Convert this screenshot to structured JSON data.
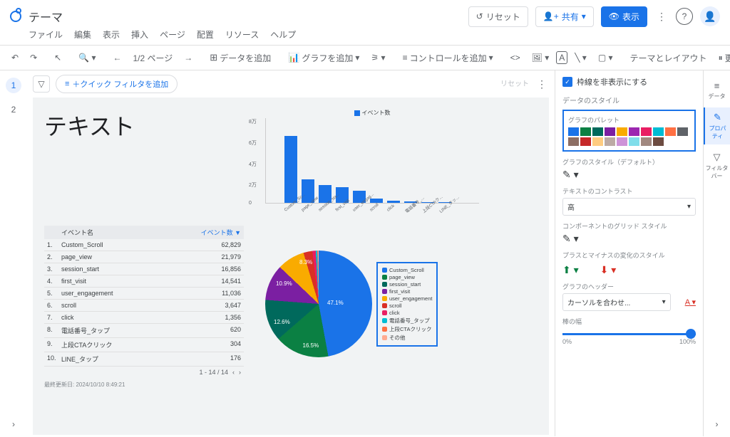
{
  "header": {
    "title": "テーマ",
    "reset": "リセット",
    "share": "共有",
    "view": "表示"
  },
  "menu": [
    "ファイル",
    "編集",
    "表示",
    "挿入",
    "ページ",
    "配置",
    "リソース",
    "ヘルプ"
  ],
  "toolbar": {
    "page_info": "1/2 ページ",
    "add_data": "データを追加",
    "add_chart": "グラフを追加",
    "add_control": "コントロールを追加",
    "theme_layout": "テーマとレイアウト",
    "pause_update": "更新を一時停止"
  },
  "filter": {
    "quick": "＋クイック フィルタを追加",
    "reset": "リセット"
  },
  "canvas": {
    "text_title": "テキスト",
    "updated": "最終更新日: 2024/10/10 8:49:21",
    "table": {
      "col_name": "イベント名",
      "col_count": "イベント数",
      "rows": [
        {
          "n": "1.",
          "name": "Custom_Scroll",
          "v": "62,829"
        },
        {
          "n": "2.",
          "name": "page_view",
          "v": "21,979"
        },
        {
          "n": "3.",
          "name": "session_start",
          "v": "16,856"
        },
        {
          "n": "4.",
          "name": "first_visit",
          "v": "14,541"
        },
        {
          "n": "5.",
          "name": "user_engagement",
          "v": "11,036"
        },
        {
          "n": "6.",
          "name": "scroll",
          "v": "3,647"
        },
        {
          "n": "7.",
          "name": "click",
          "v": "1,356"
        },
        {
          "n": "8.",
          "name": "電話番号_タップ",
          "v": "620"
        },
        {
          "n": "9.",
          "name": "上段CTAクリック",
          "v": "304"
        },
        {
          "n": "10.",
          "name": "LINE_タップ",
          "v": "176"
        }
      ],
      "footer": "1 - 14 / 14"
    }
  },
  "chart_data": [
    {
      "type": "bar",
      "title": "",
      "legend": "イベント数",
      "categories": [
        "Custom_Sc...",
        "page_view",
        "session_sta...",
        "first_visit",
        "user_engag...",
        "scroll",
        "click",
        "電話番号_...",
        "上段CTAク...",
        "LINE_タッ..."
      ],
      "values": [
        62829,
        21979,
        16856,
        14541,
        11036,
        3647,
        1356,
        620,
        304,
        176
      ],
      "ylim": [
        0,
        80000
      ],
      "yticks": [
        "8万",
        "6万",
        "4万",
        "2万",
        "0"
      ]
    },
    {
      "type": "pie",
      "labels_shown": [
        "47.1%",
        "16.5%",
        "12.6%",
        "10.9%",
        "8.3%"
      ],
      "series": [
        {
          "name": "Custom_Scroll",
          "value": 47.1,
          "color": "#1a73e8"
        },
        {
          "name": "page_view",
          "value": 16.5,
          "color": "#0b8043"
        },
        {
          "name": "session_start",
          "value": 12.6,
          "color": "#00695c"
        },
        {
          "name": "first_visit",
          "value": 10.9,
          "color": "#7b1fa2"
        },
        {
          "name": "user_engagement",
          "value": 8.3,
          "color": "#f9ab00"
        },
        {
          "name": "scroll",
          "value": 2.7,
          "color": "#d93025"
        },
        {
          "name": "click",
          "value": 1.0,
          "color": "#e91e63"
        },
        {
          "name": "電話番号_タップ",
          "value": 0.5,
          "color": "#00bcd4"
        },
        {
          "name": "上段CTAクリック",
          "value": 0.2,
          "color": "#ff7043"
        },
        {
          "name": "その他",
          "value": 0.2,
          "color": "#ffab91"
        }
      ]
    }
  ],
  "rpanel": {
    "hide_border": "枠線を非表示にする",
    "data_style": "データのスタイル",
    "palette_title": "グラフのパレット",
    "palette": [
      "#1a73e8",
      "#0b8043",
      "#00695c",
      "#7b1fa2",
      "#f9ab00",
      "#9c27b0",
      "#e91e63",
      "#00bcd4",
      "#ff7043",
      "#5f6368",
      "#8d6e63",
      "#c62828",
      "#ffcc80",
      "#bcaaa4",
      "#ce93d8",
      "#80deea",
      "#a1887f",
      "#6d4c41"
    ],
    "chart_style": "グラフのスタイル（デフォルト）",
    "text_contrast": "テキストのコントラスト",
    "contrast_value": "高",
    "grid_style": "コンポーネントのグリッド スタイル",
    "plus_minus": "プラスとマイナスの変化のスタイル",
    "chart_header": "グラフのヘッダー",
    "header_value": "カーソルを合わせ...",
    "bar_width": "棒の幅",
    "slider_min": "0%",
    "slider_max": "100%"
  },
  "rtabs": {
    "data": "データ",
    "prop": "プロパティ",
    "filter": "フィルタバー"
  }
}
